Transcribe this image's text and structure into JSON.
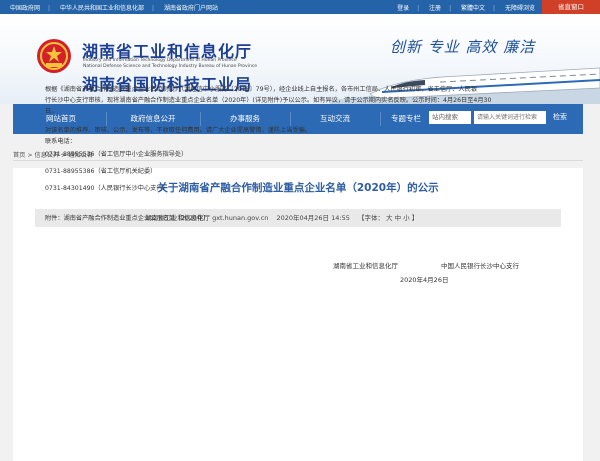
{
  "topbar": {
    "links_left": [
      "中国政府网",
      "中华人民共和国工业和信息化部",
      "湖南省政府门户网站"
    ],
    "links_right": [
      "登录",
      "注册",
      "繁體中文",
      "无障碍浏览"
    ],
    "gov_window": "省直窗口"
  },
  "header": {
    "title_cn_1": "湖南省工业和信息化厅",
    "title_en_1": "Industry and Information Technology Department of Hunan Province",
    "title_en_2": "National Defense Science and Technology Industry Bureau of Hunan Province",
    "title_cn_2": "湖南省国防科技工业局",
    "slogan": "创新 专业 高效 廉洁"
  },
  "nav": {
    "items": [
      "网站首页",
      "政府信息公开",
      "办事服务",
      "互动交流",
      "专题专栏"
    ],
    "search_scope": "站内搜索",
    "search_placeholder": "请输入关键词进行检索",
    "search_button": "检索"
  },
  "breadcrumb": "首页 > 信息公开 > 通知公告",
  "article": {
    "title": "关于湖南省产融合作制造业重点企业名单（2020年）的公示",
    "source": "湖南省工业和信息化厅 gxt.hunan.gov.cn",
    "date": "2020年04月26日 14:55",
    "font_label": "【字体：",
    "font_sizes": [
      "大",
      "中",
      "小"
    ],
    "font_close": "】",
    "para1_lines": [
      "根据《湖南省产融合作制造业重点企业名单制度》（湘经信中小服务〔2018〕79号），经企业线上自主报名，各市州工信局、人民银行初审，省工信厅、人民银",
      "行长沙中心支行审核，现将湖南省产融合作制造业重点企业名单（2020年）(详见附件)予以公示。如有异议，请于公示期内实名反映。公示时间：4月26日至4月30",
      "日。"
    ],
    "para2": "对该名单的推荐、审核、公示、发布等，不收取任何费用。请广大企业提高警惕，谨防上当受骗。",
    "contact_label": "联系电话：",
    "contacts": [
      "0731-88955536（省工信厅中小企业服务指导处）",
      "0731-88955386（省工信厅机关纪委）",
      "0731-84301490（人民银行长沙中心支行）"
    ],
    "attachment": "附件：湖南省产融合作制造业重点企业公示名单（2020年）",
    "signers": [
      "湖南省工业和信息化厅",
      "中国人民银行长沙中心支行"
    ],
    "sign_date": "2020年4月26日"
  },
  "colors": {
    "topbar": "#2463a7",
    "nav": "#2d6ab5",
    "gov_window": "#d04028",
    "title": "#2e5da4"
  }
}
